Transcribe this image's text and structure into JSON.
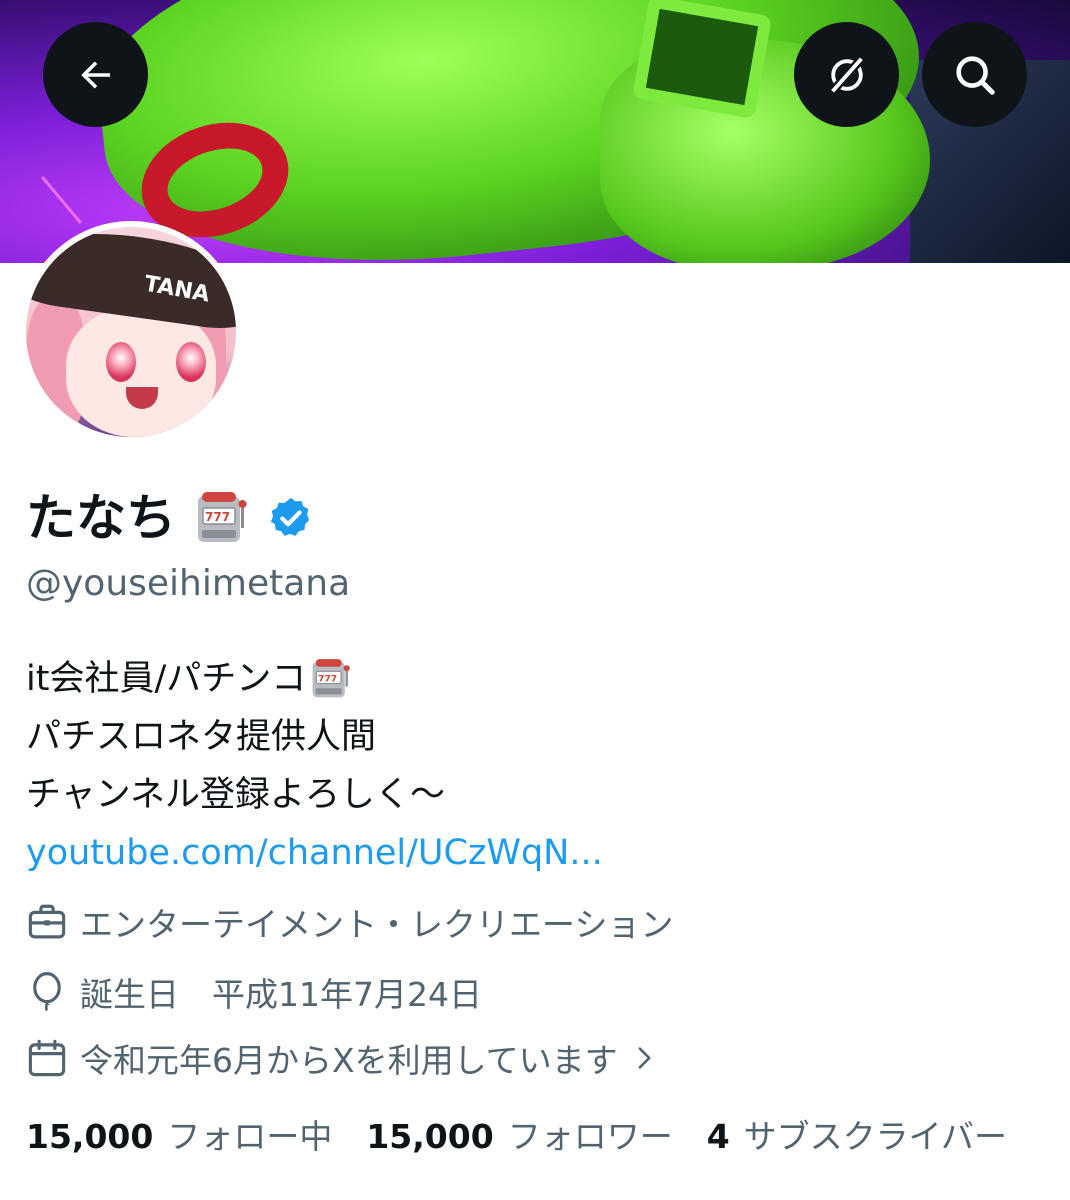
{
  "profile": {
    "name": "たなち",
    "handle": "@youseihimetana",
    "avatar_cap_text": "TANA",
    "verified_color": "#1d9bf0",
    "bio": {
      "line1": "it会社員/パチンコ",
      "line2": "パチスロネタ提供人間",
      "line3": "チャンネル登録よろしく～",
      "link": "youtube.com/channel/UCzWqN..."
    },
    "category": "エンターテイメント・レクリエーション",
    "birthday": "誕生日　平成11年7月24日",
    "joined": "令和元年6月からXを利用しています"
  },
  "stats": {
    "following_count": "15,000",
    "following_label": "フォロー中",
    "followers_count": "15,000",
    "followers_label": "フォロワー",
    "subscribers_count": "4",
    "subscribers_label": "サブスクライバー"
  },
  "icons": {
    "back": "back-arrow-icon",
    "grok": "grok-icon",
    "search": "search-icon",
    "verified": "verified-badge-icon",
    "slot": "slot-machine-emoji",
    "category": "briefcase-icon",
    "birthday": "balloon-icon",
    "joined": "calendar-icon"
  },
  "colors": {
    "accent": "#1d9bf0",
    "text_primary": "#0f1419",
    "text_secondary": "#536471"
  }
}
